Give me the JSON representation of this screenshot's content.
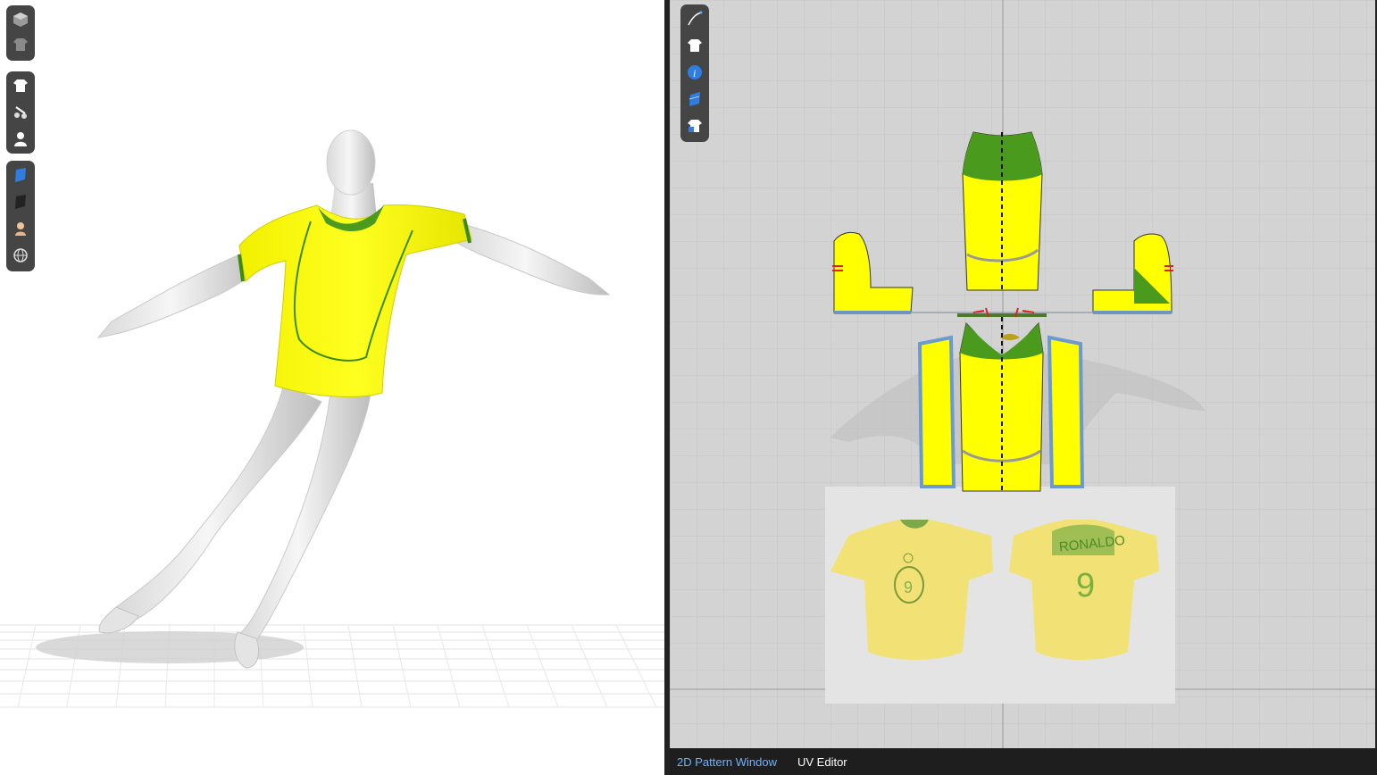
{
  "viewport3d": {
    "toolbar_groups": [
      [
        "avatar-box-icon",
        "garment-grey-icon"
      ],
      [
        "shirt-icon",
        "sewing-tool-icon",
        "avatar-icon"
      ],
      [
        "blue-fabric-icon",
        "dark-fabric-icon",
        "skin-icon",
        "globe-icon"
      ]
    ]
  },
  "pattern_window": {
    "toolbar": [
      "pen-tool-icon",
      "shirt-icon",
      "info-icon",
      "fabric-icon",
      "shirt-lock-icon"
    ],
    "reference_back_text": "RONALDO",
    "reference_number": "9"
  },
  "tabs": {
    "pattern_window": "2D Pattern Window",
    "uv_editor": "UV Editor"
  },
  "colors": {
    "fabric_yellow": "#ffff00",
    "trim_green": "#4a9a1e",
    "active_tab": "#6fb3ff",
    "grid_bg": "#d3d3d3",
    "toolbar_bg": "#454545"
  }
}
